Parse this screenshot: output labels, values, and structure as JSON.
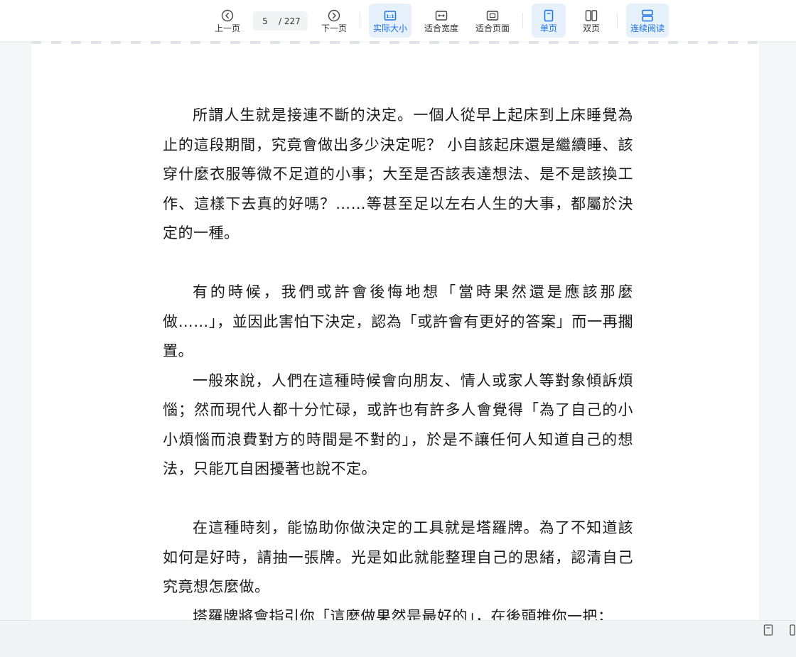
{
  "toolbar": {
    "prev_label": "上一页",
    "next_label": "下一页",
    "page_current": "5",
    "page_total": "/ 227",
    "actual_size_label": "实际大小",
    "fit_width_label": "适合宽度",
    "fit_page_label": "适合页面",
    "single_page_label": "单页",
    "double_page_label": "双页",
    "continuous_label": "连续阅读",
    "active_color": "#1a73e8",
    "active_bg": "#e6f1fc"
  },
  "document": {
    "paragraphs": [
      "所謂人生就是接連不斷的決定。一個人從早上起床到上床睡覺為止的這段期間，究竟會做出多少決定呢？ 小自該起床還是繼續睡、該穿什麼衣服等微不足道的小事；大至是否該表達想法、是不是該換工作、這樣下去真的好嗎？……等甚至足以左右人生的大事，都屬於決定的一種。",
      "有的時候，我們或許會後悔地想「當時果然還是應該那麼做……」，並因此害怕下決定，認為「或許會有更好的答案」而一再擱置。",
      "一般來說，人們在這種時候會向朋友、情人或家人等對象傾訴煩惱；然而現代人都十分忙碌，或許也有許多人會覺得「為了自己的小小煩惱而浪費對方的時間是不對的」，於是不讓任何人知道自己的想法，只能兀自困擾著也說不定。",
      "在這種時刻，能協助你做決定的工具就是塔羅牌。為了不知道該如何是好時，請抽一張牌。光是如此就能整理自己的思緒，認清自己究竟想怎麼做。",
      "塔羅牌將會指引你「這麼做果然是最好的」，在後頭推你一把；"
    ]
  }
}
